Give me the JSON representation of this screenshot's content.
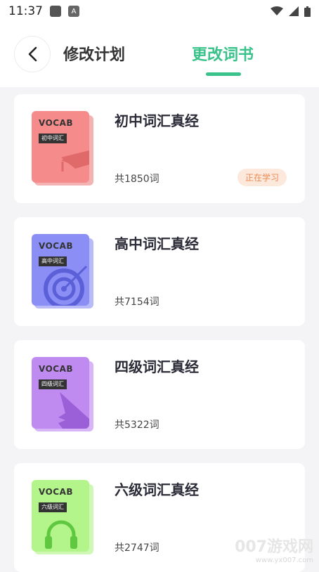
{
  "status_bar": {
    "time": "11:37",
    "notification_icon": "A"
  },
  "header": {
    "tab_plan": "修改计划",
    "tab_book": "更改词书"
  },
  "books": [
    {
      "cover_word": "VOCAB",
      "cover_label": "初中词汇",
      "title": "初中词汇真经",
      "count": "共1850词",
      "badge": "正在学习",
      "color": "#f58b8b",
      "shadow": "#e06a6a",
      "icon": "graduation-cap-icon"
    },
    {
      "cover_word": "VOCAB",
      "cover_label": "高中词汇",
      "title": "高中词汇真经",
      "count": "共7154词",
      "color": "#8b8ef5",
      "shadow": "#5b60d8",
      "icon": "target-icon"
    },
    {
      "cover_word": "VOCAB",
      "cover_label": "四级词汇",
      "title": "四级词汇真经",
      "count": "共5322词",
      "color": "#c08bf0",
      "shadow": "#9b5fd8",
      "icon": "airplane-icon"
    },
    {
      "cover_word": "VOCAB",
      "cover_label": "六级词汇",
      "title": "六级词汇真经",
      "count": "共2747词",
      "color": "#b3f58b",
      "shadow": "#7fd85b",
      "icon": "headphones-icon"
    }
  ],
  "watermark": {
    "main": "007游戏网",
    "sub": "www.yx007.com"
  }
}
